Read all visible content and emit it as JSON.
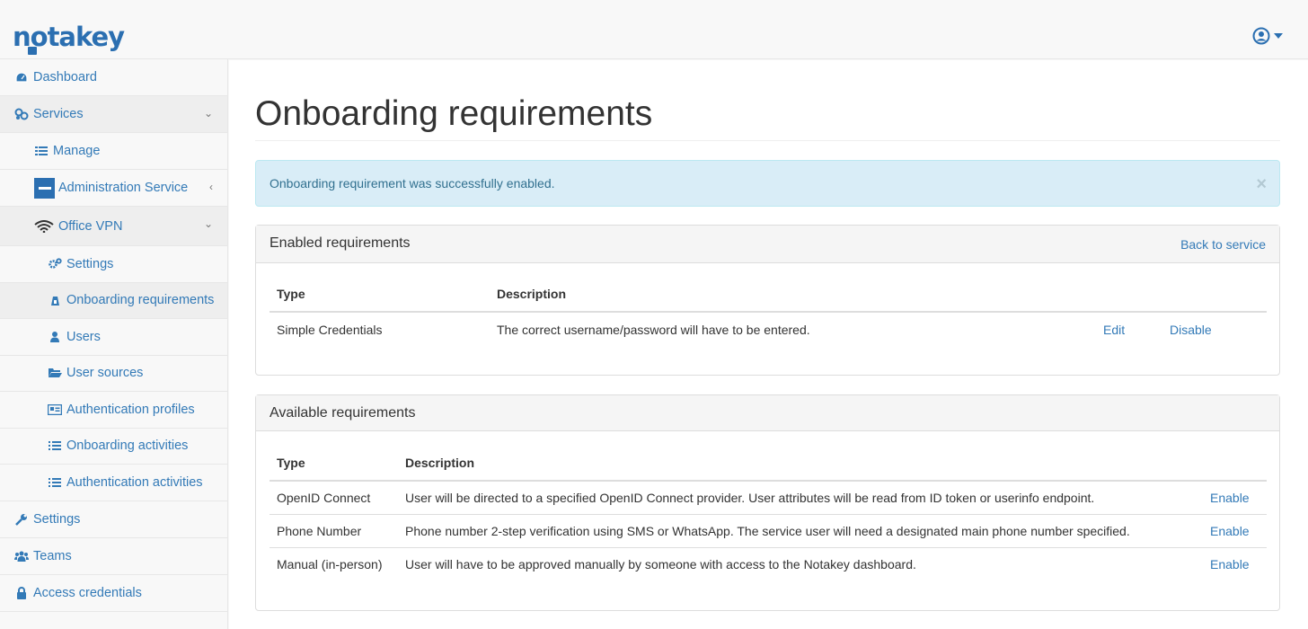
{
  "app": {
    "logo_text": "notakey"
  },
  "colors": {
    "brand": "#2b6fb1",
    "link": "#337ab7",
    "alert_bg": "#d9edf7",
    "alert_text": "#31708f"
  },
  "sidebar": {
    "items": [
      {
        "label": "Dashboard",
        "icon": "dashboard-icon"
      },
      {
        "label": "Services",
        "icon": "services-icon",
        "expanded": true
      },
      {
        "label": "Manage",
        "icon": "list-icon"
      },
      {
        "label": "Administration Service",
        "icon": "admin-service-logo"
      },
      {
        "label": "Office VPN",
        "icon": "wifi-icon",
        "expanded": true
      },
      {
        "label": "Settings",
        "icon": "cogs-icon"
      },
      {
        "label": "Onboarding requirements",
        "icon": "onboarding-icon",
        "active": true
      },
      {
        "label": "Users",
        "icon": "user-icon"
      },
      {
        "label": "User sources",
        "icon": "folder-icon"
      },
      {
        "label": "Authentication profiles",
        "icon": "id-card-icon"
      },
      {
        "label": "Onboarding activities",
        "icon": "list-icon"
      },
      {
        "label": "Authentication activities",
        "icon": "list-icon"
      },
      {
        "label": "Settings",
        "icon": "wrench-icon"
      },
      {
        "label": "Teams",
        "icon": "users-icon"
      },
      {
        "label": "Access credentials",
        "icon": "lock-icon"
      }
    ]
  },
  "main": {
    "title": "Onboarding requirements",
    "alert": {
      "message": "Onboarding requirement was successfully enabled.",
      "close": "×"
    },
    "enabled": {
      "heading": "Enabled requirements",
      "back_link": "Back to service",
      "columns": [
        "Type",
        "Description"
      ],
      "rows": [
        {
          "type": "Simple Credentials",
          "description": "The correct username/password will have to be entered.",
          "edit": "Edit",
          "disable": "Disable"
        }
      ]
    },
    "available": {
      "heading": "Available requirements",
      "columns": [
        "Type",
        "Description"
      ],
      "rows": [
        {
          "type": "OpenID Connect",
          "description": "User will be directed to a specified OpenID Connect provider. User attributes will be read from ID token or userinfo endpoint.",
          "action": "Enable"
        },
        {
          "type": "Phone Number",
          "description": "Phone number 2-step verification using SMS or WhatsApp. The service user will need a designated main phone number specified.",
          "action": "Enable"
        },
        {
          "type": "Manual (in-person)",
          "description": "User will have to be approved manually by someone with access to the Notakey dashboard.",
          "action": "Enable"
        }
      ]
    }
  }
}
